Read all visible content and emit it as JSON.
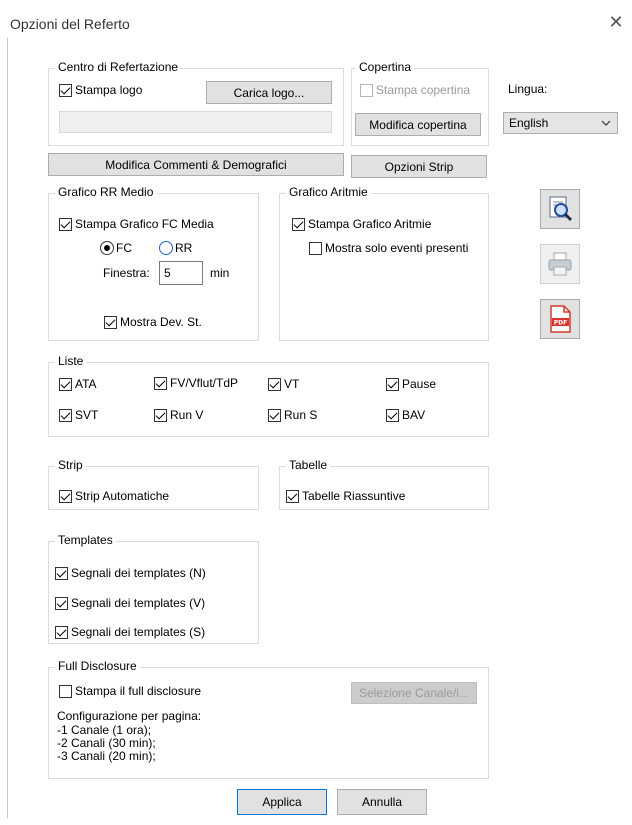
{
  "window": {
    "title": "Opzioni del Referto",
    "close_glyph": "✕"
  },
  "centro": {
    "legend": "Centro di Refertazione",
    "stampa_logo": "Stampa logo",
    "carica_logo": "Carica logo..."
  },
  "copertina": {
    "legend": "Copertina",
    "stampa_copertina": "Stampa copertina",
    "modifica_copertina": "Modifica copertina"
  },
  "lingua": {
    "label": "Lingua:",
    "value": "English"
  },
  "buttons": {
    "modifica_commenti": "Modifica Commenti & Demografici",
    "opzioni_strip": "Opzioni Strip",
    "applica": "Applica",
    "annulla": "Annulla"
  },
  "rr_medio": {
    "legend": "Grafico RR Medio",
    "stampa_fc": "Stampa Grafico FC Media",
    "fc": "FC",
    "rr": "RR",
    "finestra_label": "Finestra:",
    "finestra_value": "5",
    "finestra_unit": "min",
    "mostra_dev": "Mostra Dev. St."
  },
  "aritmie": {
    "legend": "Grafico Aritmie",
    "stampa": "Stampa Grafico Aritmie",
    "solo_eventi": "Mostra solo eventi presenti"
  },
  "liste": {
    "legend": "Liste",
    "items": [
      "ATA",
      "FV/Vflut/TdP",
      "VT",
      "Pause",
      "SVT",
      "Run V",
      "Run S",
      "BAV"
    ]
  },
  "strip": {
    "legend": "Strip",
    "auto": "Strip Automatiche"
  },
  "tabelle": {
    "legend": "Tabelle",
    "riassuntive": "Tabelle Riassuntive"
  },
  "templates": {
    "legend": "Templates",
    "items": [
      "Segnali dei templates (N)",
      "Segnali dei templates (V)",
      "Segnali dei templates (S)"
    ]
  },
  "full_disclosure": {
    "legend": "Full Disclosure",
    "stampa": "Stampa il full disclosure",
    "selezione": "Selezione Canale/i...",
    "config_title": "Configurazione per pagina:",
    "config_lines": [
      "-1 Canale (1 ora);",
      "-2 Canali (30 min);",
      "-3 Canali (20 min);"
    ]
  },
  "icons": [
    "preview-icon",
    "printer-icon",
    "pdf-icon"
  ]
}
